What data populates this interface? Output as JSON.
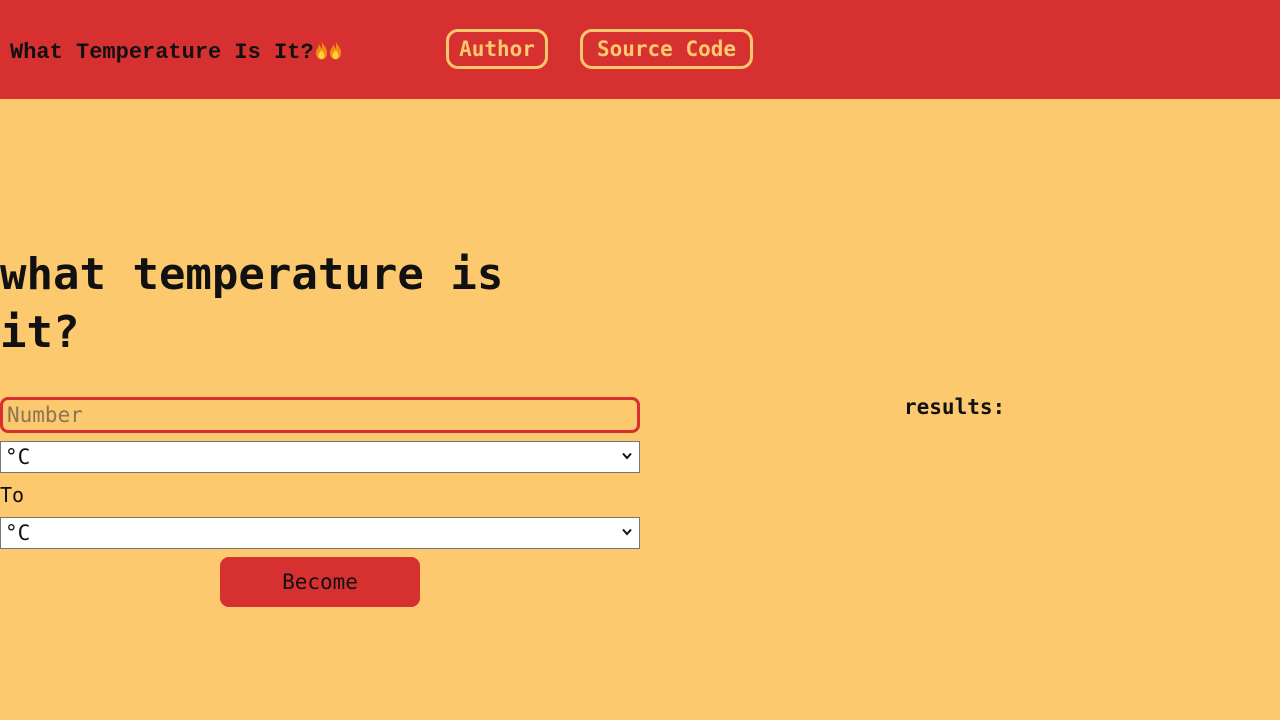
{
  "header": {
    "title": "What Temperature Is It?",
    "title_icons": [
      "fire-icon",
      "fire-icon"
    ],
    "nav": {
      "author_label": "Author",
      "source_label": "Source Code"
    },
    "background_color": "#d73030",
    "accent_color": "#fdc96f"
  },
  "main": {
    "heading": "what temperature is it?",
    "number_input": {
      "placeholder": "Number",
      "value": ""
    },
    "from_unit": {
      "selected": "°C"
    },
    "to_label": "To",
    "to_unit": {
      "selected": "°C"
    },
    "convert_button_label": "Become",
    "background_color": "#fdc96f"
  },
  "results": {
    "label": "results:"
  }
}
